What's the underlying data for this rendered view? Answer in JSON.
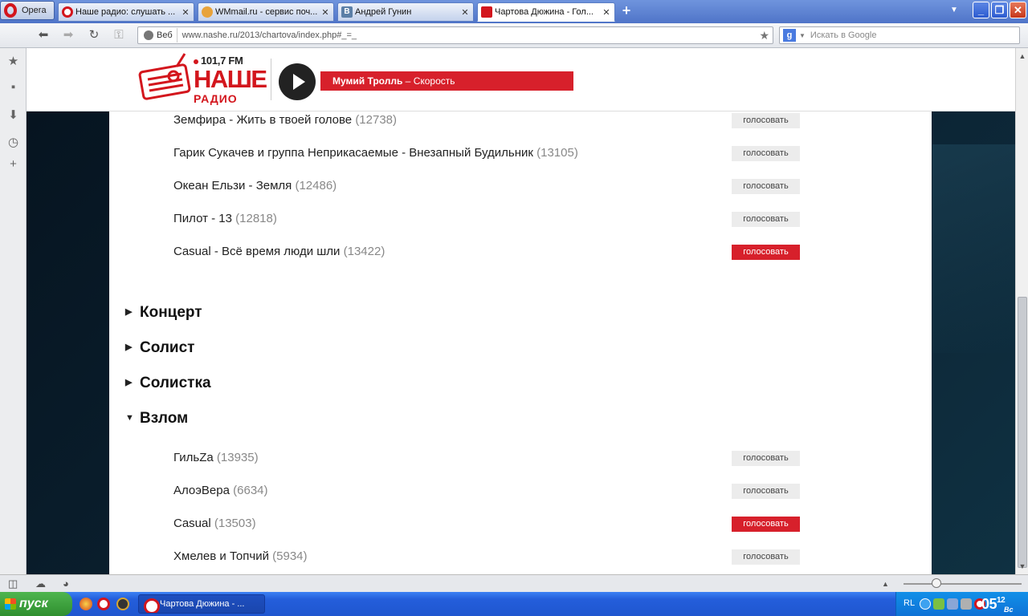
{
  "browser": {
    "opera_label": "Opera",
    "tabs": [
      {
        "title": "Наше радио: слушать ...",
        "close": "✕",
        "favicon_color": "#d3161d"
      },
      {
        "title": "WMmail.ru - сервис поч...",
        "close": "✕",
        "favicon_color": "#e8a33b"
      },
      {
        "title": "Андрей Гунин",
        "close": "✕",
        "favicon_color": "#5b7fa7"
      },
      {
        "title": "Чартова Дюжина - Гол...",
        "close": "✕",
        "favicon_color": "#d3161d"
      }
    ],
    "new_tab": "+",
    "url": "www.nashe.ru/2013/chartova/index.php#_=_",
    "web_label": "Веб",
    "search_placeholder": "Искать в Google",
    "search_engine_glyph": "g"
  },
  "site": {
    "frequency": "101,7 FM",
    "logo_line1": "НАШЕ",
    "logo_line2": "РАДИО",
    "now_playing_artist": "Мумий Тролль",
    "now_playing_sep": " – ",
    "now_playing_track": "Скорость",
    "brand_color": "#d7202b"
  },
  "vote_label": "голосовать",
  "top_list": [
    {
      "title": "Земфира - Жить в твоей голове",
      "count": "(12738)",
      "voted": false
    },
    {
      "title": "Гарик Сукачев и группа Неприкасаемые - Внезапный Будильник",
      "count": "(13105)",
      "voted": false
    },
    {
      "title": "Океан Ельзи - Земля",
      "count": "(12486)",
      "voted": false
    },
    {
      "title": "Пилот - 13",
      "count": "(12818)",
      "voted": false
    },
    {
      "title": "Casual - Всё время люди шли",
      "count": "(13422)",
      "voted": true
    }
  ],
  "categories": [
    {
      "name": "Концерт",
      "expanded": false
    },
    {
      "name": "Солист",
      "expanded": false
    },
    {
      "name": "Солистка",
      "expanded": false
    },
    {
      "name": "Взлом",
      "expanded": true
    }
  ],
  "vzlom_list": [
    {
      "title": "ГильZa",
      "count": "(13935)",
      "voted": false
    },
    {
      "title": "АлоэВера",
      "count": "(6634)",
      "voted": false
    },
    {
      "title": "Casual",
      "count": "(13503)",
      "voted": true
    },
    {
      "title": "Хмелев и Топчий",
      "count": "(5934)",
      "voted": false
    }
  ],
  "taskbar": {
    "start_label": "пуск",
    "task_title": "Чартова Дюжина - ...",
    "lang": "RL",
    "clock_hours": "05",
    "clock_minutes": "12",
    "clock_day": "Вс"
  }
}
